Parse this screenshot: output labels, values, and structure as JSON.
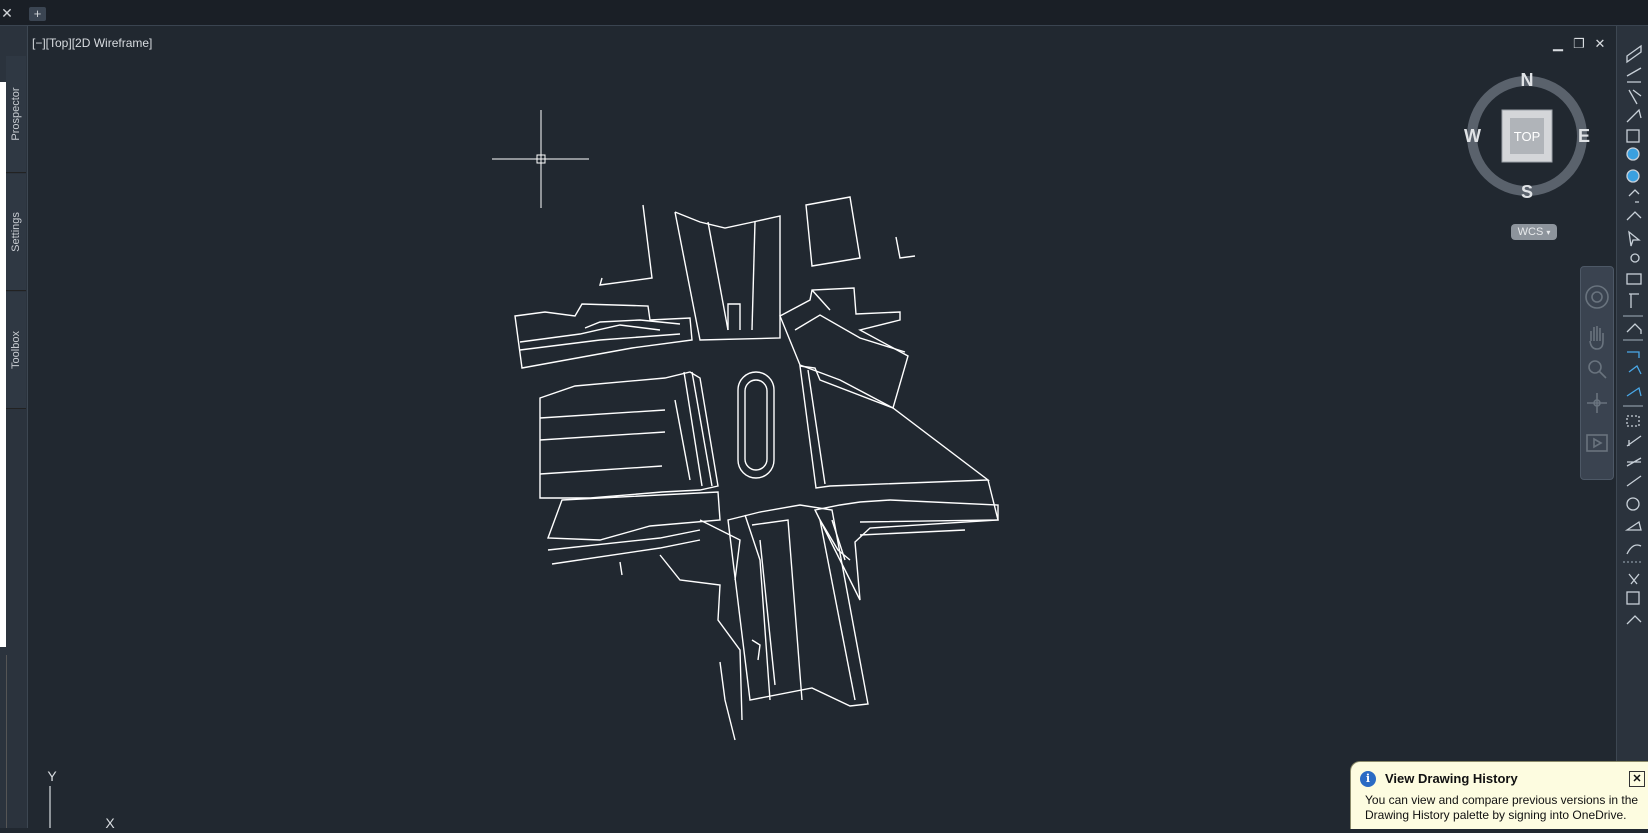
{
  "tabs": {
    "close_glyph": "✕",
    "add_glyph": "+"
  },
  "left_palette": {
    "tabs": [
      "Prospector",
      "Settings",
      "Toolbox"
    ]
  },
  "viewport": {
    "label": "[−][Top][2D Wireframe]",
    "minimize_glyph": "▁",
    "restore_glyph": "❐",
    "close_glyph": "✕"
  },
  "viewcube": {
    "north": "N",
    "south": "S",
    "east": "E",
    "west": "W",
    "face": "TOP",
    "wcs_label": "WCS"
  },
  "ucs": {
    "y_label": "Y",
    "x_label": "X"
  },
  "notification": {
    "info_glyph": "i",
    "title": "View Drawing History",
    "body": "You can view and compare previous versions in the Drawing History palette by signing into OneDrive.",
    "close_glyph": "✕"
  },
  "colors": {
    "background": "#212830",
    "linework": "#ffffff",
    "notification_bg": "#fdfce0",
    "info": "#2a6bc4"
  },
  "icons": {
    "right_toolbar": [
      "plan-icon",
      "profile-icon",
      "alignment-icon",
      "corridor-icon",
      "section-icon",
      "surface-icon",
      "globe-icon",
      "point-icon",
      "label-icon",
      "select-icon",
      "inquiry-icon",
      "sheet-icon",
      "parcel-icon",
      "grading-icon",
      "pipe-icon",
      "structure-icon",
      "feature-line-icon",
      "sample-line-icon",
      "assembly-icon",
      "measure-icon",
      "dimension-icon",
      "annotation-icon",
      "style-icon",
      "edit-icon",
      "transform-icon",
      "layout-icon",
      "pressure-pipe-icon"
    ],
    "nav_bar": [
      "steering-wheel-icon",
      "pan-icon",
      "zoom-icon",
      "orbit-icon",
      "showmotion-icon"
    ]
  }
}
